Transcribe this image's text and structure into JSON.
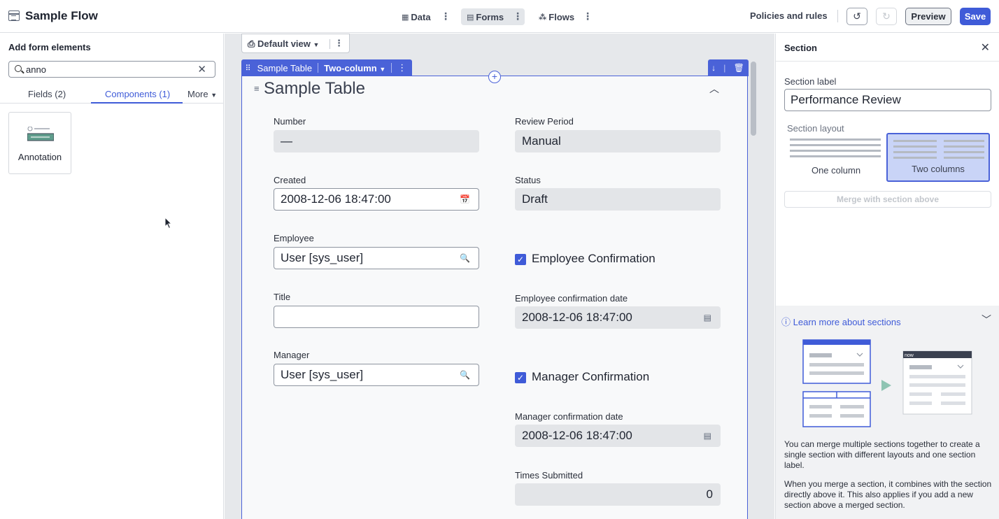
{
  "app": {
    "title": "Sample Flow"
  },
  "nav": {
    "tabs": [
      {
        "label": "Data",
        "icon": "table-icon",
        "active": false
      },
      {
        "label": "Forms",
        "icon": "forms-icon",
        "active": true
      },
      {
        "label": "Flows",
        "icon": "flows-icon",
        "active": false
      }
    ],
    "policies": "Policies and rules",
    "preview": "Preview",
    "save": "Save"
  },
  "left_panel": {
    "title": "Add form elements",
    "search_value": "anno",
    "tabs": [
      "Fields (2)",
      "Components (1)",
      "More"
    ],
    "active_tab": "Components (1)",
    "components": [
      {
        "label": "Annotation",
        "icon": "annotation-icon"
      }
    ]
  },
  "canvas": {
    "view": "Default view",
    "section_toolbar": {
      "name": "Sample Table",
      "layout": "Two-column"
    },
    "form_title": "Sample Table",
    "left_fields": [
      {
        "label": "Number",
        "value": "—",
        "type": "readonly"
      },
      {
        "label": "Created",
        "value": "2008-12-06 18:47:00",
        "type": "datetime"
      },
      {
        "label": "Employee",
        "value": "User [sys_user]",
        "type": "reference"
      },
      {
        "label": "Title",
        "value": "",
        "type": "text"
      },
      {
        "label": "Manager",
        "value": "User [sys_user]",
        "type": "reference"
      }
    ],
    "right_fields": {
      "review_period": {
        "label": "Review Period",
        "value": "Manual"
      },
      "status": {
        "label": "Status",
        "value": "Draft"
      },
      "employee_confirmation": "Employee Confirmation",
      "employee_confirmation_date": {
        "label": "Employee confirmation date",
        "value": "2008-12-06 18:47:00"
      },
      "manager_confirmation": "Manager Confirmation",
      "manager_confirmation_date": {
        "label": "Manager confirmation date",
        "value": "2008-12-06 18:47:00"
      },
      "times_submitted": {
        "label": "Times Submitted",
        "value": "0"
      }
    }
  },
  "right_panel": {
    "title": "Section",
    "label_caption": "Section label",
    "label_value": "Performance Review",
    "layout_caption": "Section layout",
    "layout_options": [
      "One column",
      "Two columns"
    ],
    "selected_layout": "Two columns",
    "merge_button": "Merge with section above",
    "learn_more": "Learn more about sections",
    "diagram_badge": "now",
    "paragraph1": "You can merge multiple sections together to create a single section with different layouts and one section label.",
    "paragraph2": "When you merge a section, it combines with the section directly above it. This also applies if you add a new section above a merged section."
  },
  "colors": {
    "accent": "#3f5bd8",
    "section_border": "#4a62d8",
    "selected_layout_bg": "#c9d4f7"
  }
}
